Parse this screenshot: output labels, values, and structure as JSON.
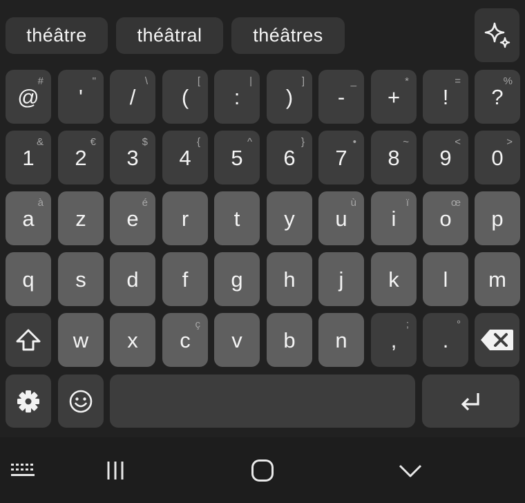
{
  "suggestions": [
    "théâtre",
    "théâtral",
    "théâtres"
  ],
  "icons": {
    "ai": "sparkle-icon",
    "shift": "shift-arrow-icon",
    "backspace": "backspace-icon",
    "settings": "gear-icon",
    "emoji": "smiley-icon",
    "enter": "enter-return-icon",
    "keyboard_toggle": "keyboard-icon",
    "recents": "recents-icon",
    "home": "home-icon",
    "hide_keyboard": "chevron-down-icon"
  },
  "rows": [
    [
      {
        "main": "@",
        "sub": "#"
      },
      {
        "main": "'",
        "sub": "\""
      },
      {
        "main": "/",
        "sub": "\\"
      },
      {
        "main": "(",
        "sub": "["
      },
      {
        "main": ":",
        "sub": "|"
      },
      {
        "main": ")",
        "sub": "]"
      },
      {
        "main": "-",
        "sub": "_"
      },
      {
        "main": "+",
        "sub": "*"
      },
      {
        "main": "!",
        "sub": "="
      },
      {
        "main": "?",
        "sub": "%"
      }
    ],
    [
      {
        "main": "1",
        "sub": "&"
      },
      {
        "main": "2",
        "sub": "€"
      },
      {
        "main": "3",
        "sub": "$"
      },
      {
        "main": "4",
        "sub": "{"
      },
      {
        "main": "5",
        "sub": "^"
      },
      {
        "main": "6",
        "sub": "}"
      },
      {
        "main": "7",
        "sub": "•"
      },
      {
        "main": "8",
        "sub": "~"
      },
      {
        "main": "9",
        "sub": "<"
      },
      {
        "main": "0",
        "sub": ">"
      }
    ],
    [
      {
        "main": "a",
        "sub": "à"
      },
      {
        "main": "z",
        "sub": ""
      },
      {
        "main": "e",
        "sub": "é"
      },
      {
        "main": "r",
        "sub": ""
      },
      {
        "main": "t",
        "sub": ""
      },
      {
        "main": "y",
        "sub": ""
      },
      {
        "main": "u",
        "sub": "ù"
      },
      {
        "main": "i",
        "sub": "ï"
      },
      {
        "main": "o",
        "sub": "œ"
      },
      {
        "main": "p",
        "sub": ""
      }
    ],
    [
      {
        "main": "q",
        "sub": ""
      },
      {
        "main": "s",
        "sub": ""
      },
      {
        "main": "d",
        "sub": ""
      },
      {
        "main": "f",
        "sub": ""
      },
      {
        "main": "g",
        "sub": ""
      },
      {
        "main": "h",
        "sub": ""
      },
      {
        "main": "j",
        "sub": ""
      },
      {
        "main": "k",
        "sub": ""
      },
      {
        "main": "l",
        "sub": ""
      },
      {
        "main": "m",
        "sub": ""
      }
    ],
    [
      {
        "main": "w",
        "sub": ""
      },
      {
        "main": "x",
        "sub": ""
      },
      {
        "main": "c",
        "sub": "ç"
      },
      {
        "main": "v",
        "sub": ""
      },
      {
        "main": "b",
        "sub": ""
      },
      {
        "main": "n",
        "sub": ""
      },
      {
        "main": ",",
        "sub": ";"
      },
      {
        "main": ".",
        "sub": "°"
      }
    ]
  ],
  "colors": {
    "background": "#212121",
    "key_dark": "#3d3d3d",
    "key_light": "#5f5f5f",
    "text": "#f2f2f2",
    "secondary_text": "#a6a6a6"
  }
}
